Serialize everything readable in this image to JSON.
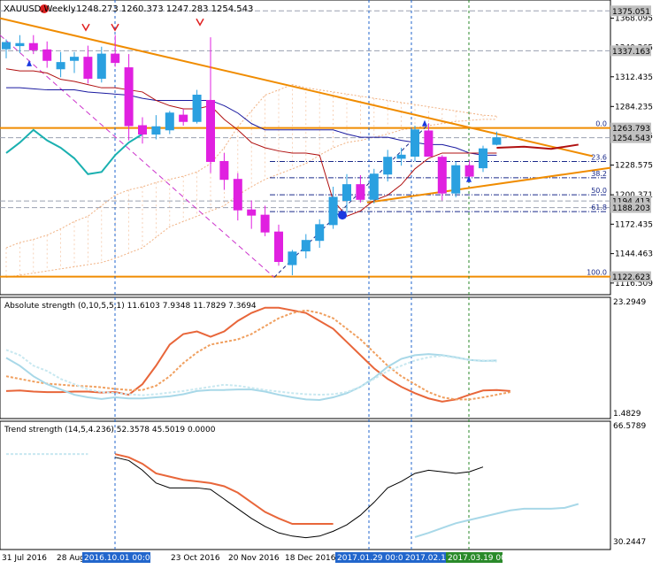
{
  "main_chart": {
    "symbol": "XAUUSD,Weekly",
    "ohlc_readout": "1248.273 1260.373 1247.283 1254.543",
    "right_axis_ticks": [
      "1368.095",
      "1340.265",
      "1312.435",
      "1284.235",
      "1256.405",
      "1228.575",
      "1200.371",
      "1172.435",
      "1144.463",
      "1116.509"
    ],
    "price_labels": [
      {
        "text": "1375.051",
        "color": "#c0c0c0"
      },
      {
        "text": "1337.163",
        "color": "#c0c0c0"
      },
      {
        "text": "1263.793",
        "color": "#c0c0c0"
      },
      {
        "text": "1254.543",
        "color": "#c0c0c0"
      },
      {
        "text": "1194.413",
        "color": "#c0c0c0"
      },
      {
        "text": "1188.203",
        "color": "#c0c0c0"
      },
      {
        "text": "1122.623",
        "color": "#c0c0c0"
      }
    ],
    "fib_levels": [
      "0.0",
      "23.6",
      "38.2",
      "50.0",
      "61.8",
      "100.0"
    ]
  },
  "chart_data": [
    {
      "type": "candlestick",
      "title": "XAUUSD,Weekly",
      "subtitle": "1248.273 1260.373 1247.283 1254.543",
      "ylim": [
        1108,
        1382
      ],
      "candles": [
        {
          "o": 1339,
          "h": 1348,
          "l": 1330,
          "c": 1345
        },
        {
          "o": 1342,
          "h": 1352,
          "l": 1335,
          "c": 1344
        },
        {
          "o": 1344,
          "h": 1352,
          "l": 1334,
          "c": 1338
        },
        {
          "o": 1338,
          "h": 1346,
          "l": 1321,
          "c": 1328
        },
        {
          "o": 1320,
          "h": 1336,
          "l": 1312,
          "c": 1326
        },
        {
          "o": 1328,
          "h": 1336,
          "l": 1316,
          "c": 1331
        },
        {
          "o": 1331,
          "h": 1342,
          "l": 1306,
          "c": 1311
        },
        {
          "o": 1311,
          "h": 1341,
          "l": 1307,
          "c": 1334
        },
        {
          "o": 1334,
          "h": 1352,
          "l": 1322,
          "c": 1326
        },
        {
          "o": 1321,
          "h": 1334,
          "l": 1252,
          "c": 1266
        },
        {
          "o": 1266,
          "h": 1274,
          "l": 1249,
          "c": 1258
        },
        {
          "o": 1258,
          "h": 1276,
          "l": 1253,
          "c": 1265
        },
        {
          "o": 1262,
          "h": 1280,
          "l": 1258,
          "c": 1278
        },
        {
          "o": 1276,
          "h": 1282,
          "l": 1266,
          "c": 1270
        },
        {
          "o": 1270,
          "h": 1300,
          "l": 1268,
          "c": 1295
        },
        {
          "o": 1290,
          "h": 1350,
          "l": 1221,
          "c": 1232
        },
        {
          "o": 1232,
          "h": 1240,
          "l": 1205,
          "c": 1215
        },
        {
          "o": 1215,
          "h": 1221,
          "l": 1176,
          "c": 1186
        },
        {
          "o": 1186,
          "h": 1195,
          "l": 1168,
          "c": 1181
        },
        {
          "o": 1181,
          "h": 1190,
          "l": 1161,
          "c": 1165
        },
        {
          "o": 1165,
          "h": 1172,
          "l": 1133,
          "c": 1137
        },
        {
          "o": 1134,
          "h": 1148,
          "l": 1124,
          "c": 1146
        },
        {
          "o": 1147,
          "h": 1163,
          "l": 1140,
          "c": 1157
        },
        {
          "o": 1157,
          "h": 1177,
          "l": 1150,
          "c": 1172
        },
        {
          "o": 1172,
          "h": 1208,
          "l": 1168,
          "c": 1198
        },
        {
          "o": 1195,
          "h": 1220,
          "l": 1183,
          "c": 1210
        },
        {
          "o": 1210,
          "h": 1219,
          "l": 1193,
          "c": 1196
        },
        {
          "o": 1196,
          "h": 1225,
          "l": 1192,
          "c": 1220
        },
        {
          "o": 1220,
          "h": 1243,
          "l": 1213,
          "c": 1236
        },
        {
          "o": 1235,
          "h": 1245,
          "l": 1228,
          "c": 1238
        },
        {
          "o": 1237,
          "h": 1266,
          "l": 1232,
          "c": 1262
        },
        {
          "o": 1261,
          "h": 1268,
          "l": 1238,
          "c": 1237
        },
        {
          "o": 1236,
          "h": 1238,
          "l": 1195,
          "c": 1202
        },
        {
          "o": 1202,
          "h": 1232,
          "l": 1198,
          "c": 1228
        },
        {
          "o": 1228,
          "h": 1233,
          "l": 1215,
          "c": 1218
        },
        {
          "o": 1226,
          "h": 1247,
          "l": 1222,
          "c": 1244
        },
        {
          "o": 1248.273,
          "h": 1260.373,
          "l": 1247.283,
          "c": 1254.543
        }
      ],
      "x_ticks": [
        "31 Jul 2016",
        "28 Aug 2016",
        "2016.10.01 00:00",
        "23 Oct 2016",
        "20 Nov 2016",
        "18 Dec 2016",
        "2017.01.29 00:00",
        "2017.02.19 00:00",
        "2017.03.19 00:00"
      ]
    },
    {
      "type": "line",
      "title": "Absolute strength (0,10,5,5,1) 11.6103 7.9348 11.7829 7.3694",
      "ylim": [
        1.4829,
        23.2949
      ],
      "y_ticks": [
        "23.2949",
        "1.4829"
      ],
      "series": [
        {
          "name": "",
          "color": "#e8663a",
          "values": [
            6.2,
            6.3,
            6.1,
            6.0,
            6.0,
            6.1,
            6.1,
            5.9,
            6.0,
            5.5,
            7.5,
            11,
            15,
            17,
            17.5,
            16.5,
            17.5,
            19.5,
            21,
            22,
            22,
            21.5,
            21,
            19.5,
            18,
            15.5,
            13,
            10.5,
            8.5,
            7,
            5.8,
            4.8,
            4.2,
            4.6,
            5.5,
            6.3,
            6.4,
            6.2
          ]
        },
        {
          "name": "",
          "color": "#f0a060",
          "values": [
            9,
            8.5,
            8,
            7.6,
            7.4,
            7.2,
            7.1,
            6.9,
            6.6,
            6.4,
            6.4,
            7.2,
            9,
            11.5,
            13.5,
            15,
            15.5,
            16,
            17,
            18.5,
            20,
            21,
            21.5,
            21,
            20,
            18,
            16,
            13.5,
            11,
            9,
            7.5,
            6,
            5,
            4.6,
            4.6,
            5,
            5.5,
            6
          ]
        },
        {
          "name": "",
          "color": "#a8d8e8",
          "values": [
            12.5,
            11,
            9,
            7.5,
            6.5,
            5.5,
            5,
            4.7,
            5,
            4.8,
            4.8,
            5,
            5.2,
            5.6,
            6.2,
            6.4,
            6.4,
            6.5,
            6.5,
            6.1,
            5.5,
            5,
            4.6,
            4.5,
            5,
            5.8,
            7,
            8.7,
            10.8,
            12.3,
            13,
            13.2,
            13,
            12.6,
            12.1,
            11.9,
            12
          ]
        },
        {
          "name": "",
          "color": "#c8e8f0",
          "values": [
            14,
            13,
            11,
            10,
            8.5,
            7.5,
            6.5,
            6,
            5.8,
            5.6,
            5.4,
            5.6,
            5.9,
            6.2,
            6.6,
            7,
            7.4,
            7.2,
            6.8,
            6.4,
            6.1,
            5.8,
            5.6,
            5.5,
            5.6,
            6,
            7,
            8.5,
            10,
            11,
            12,
            12.6,
            12.9,
            12.5,
            12.1,
            12,
            11.8
          ]
        }
      ]
    },
    {
      "type": "line",
      "title": "Trend strength (14,5,4.236) 52.3578 45.5019 0.0000",
      "ylim": [
        30.2447,
        66.5789
      ],
      "y_ticks": [
        "66.5789",
        "30.2447"
      ],
      "series": [
        {
          "name": "",
          "color": "#e8663a",
          "values": [
            null,
            null,
            null,
            null,
            null,
            null,
            null,
            null,
            58,
            57,
            55,
            52,
            51,
            50,
            49.5,
            49,
            48,
            46,
            43,
            40,
            38,
            36.3,
            36.3,
            36.3,
            36.3
          ]
        },
        {
          "name": "",
          "color": "#000000",
          "values": [
            null,
            null,
            null,
            null,
            null,
            null,
            null,
            null,
            57,
            56,
            53,
            49,
            47.5,
            47.5,
            47.5,
            47,
            44,
            41,
            38,
            35.5,
            33.5,
            32.5,
            32,
            32.5,
            34,
            36,
            39,
            43,
            47.5,
            49.5,
            52,
            53,
            52.5,
            52,
            52.5,
            54
          ]
        },
        {
          "name": "",
          "color": "#a8d8e8",
          "values": [
            null,
            null,
            null,
            null,
            null,
            null,
            null,
            null,
            null,
            null,
            null,
            null,
            null,
            null,
            null,
            null,
            null,
            null,
            null,
            null,
            null,
            null,
            null,
            null,
            null,
            null,
            null,
            null,
            null,
            null,
            32.2,
            33.5,
            35,
            36.5,
            37.5,
            38.5,
            39.5,
            40.5,
            41,
            41,
            41,
            41.3,
            42.5
          ]
        },
        {
          "name": "",
          "color": "#c8e8f0",
          "values": [
            58,
            58,
            58,
            58,
            58,
            58,
            58
          ]
        }
      ]
    }
  ]
}
